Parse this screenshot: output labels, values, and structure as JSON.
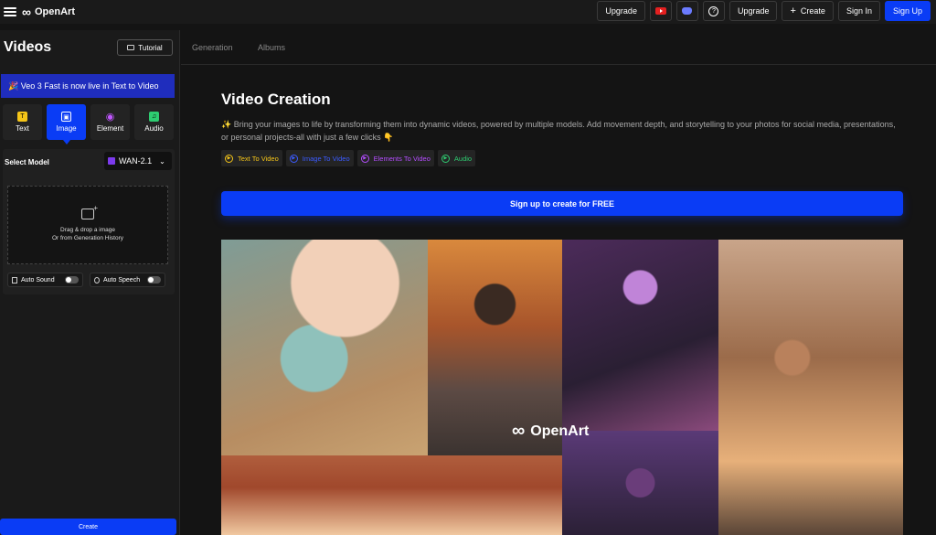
{
  "topbar": {
    "logo": "OpenArt",
    "buttons": {
      "upgrade_primary": "Upgrade",
      "upgrade_secondary": "Upgrade",
      "create": "Create",
      "sign_in": "Sign In",
      "sign_up": "Sign Up"
    },
    "icons": [
      "youtube-icon",
      "discord-icon",
      "help-icon"
    ],
    "create_prefix": "+"
  },
  "sidebar": {
    "title": "Videos",
    "tutorial_label": "Tutorial",
    "banner": "🎉 Veo 3 Fast is now live in Text to Video",
    "modes": [
      {
        "label": "Text",
        "icon": "T",
        "color": "#f5c518"
      },
      {
        "label": "Image",
        "icon": "▣",
        "color": "#4d7cff"
      },
      {
        "label": "Element",
        "icon": "◉",
        "color": "#c056ff"
      },
      {
        "label": "Audio",
        "icon": "♫",
        "color": "#2ecc71"
      }
    ],
    "select_model_label": "Select Model",
    "model_value": "WAN-2.1",
    "dropzone_line1": "Drag & drop a image",
    "dropzone_line2": "Or from Generation History",
    "auto_sound": "Auto Sound",
    "auto_speech": "Auto Speech",
    "create_label": "Create"
  },
  "main": {
    "tabs": [
      "Generation",
      "Albums"
    ],
    "heading": "Video Creation",
    "description": "✨ Bring your images to life by transforming them into dynamic videos, powered by multiple models. Add movement depth, and storytelling to your photos for social media, presentations, or personal projects-all with just a few clicks 👇",
    "chips": [
      {
        "label": "Text To Video",
        "color": "#f5c518"
      },
      {
        "label": "Image To Video",
        "color": "#3b5bff"
      },
      {
        "label": "Elements To Video",
        "color": "#b44dff"
      },
      {
        "label": "Audio",
        "color": "#2ecc71"
      }
    ],
    "signup_cta": "Sign up to create for FREE",
    "watermark": "OpenArt"
  }
}
